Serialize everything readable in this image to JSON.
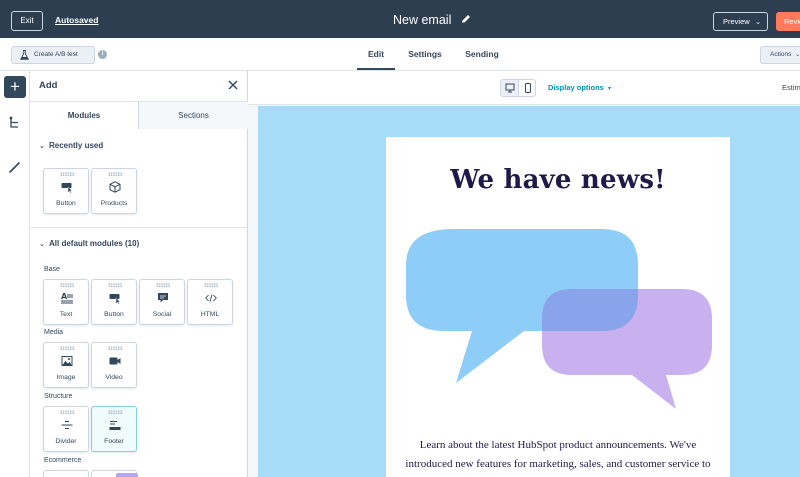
{
  "topbar": {
    "exit_label": "Exit",
    "autosaved_label": "Autosaved",
    "email_title": "New email",
    "preview_label": "Preview",
    "review_label": "Revie"
  },
  "subbar": {
    "ab_test_label": "Create A/B test",
    "tabs": [
      {
        "label": "Edit",
        "active": true
      },
      {
        "label": "Settings",
        "active": false
      },
      {
        "label": "Sending",
        "active": false
      }
    ],
    "actions_label": "Actions"
  },
  "panel": {
    "title": "Add",
    "tabs": [
      {
        "label": "Modules"
      },
      {
        "label": "Sections"
      }
    ],
    "recently_used": {
      "heading": "Recently used",
      "items": [
        {
          "label": "Button",
          "icon": "button-icon"
        },
        {
          "label": "Products",
          "icon": "cube-icon"
        }
      ]
    },
    "all_modules": {
      "heading": "All default modules (10)",
      "groups": [
        {
          "label": "Base",
          "items": [
            {
              "label": "Text",
              "icon": "text-icon"
            },
            {
              "label": "Button",
              "icon": "button-icon"
            },
            {
              "label": "Social",
              "icon": "social-icon"
            },
            {
              "label": "HTML",
              "icon": "code-icon"
            }
          ]
        },
        {
          "label": "Media",
          "items": [
            {
              "label": "Image",
              "icon": "image-icon"
            },
            {
              "label": "Video",
              "icon": "video-icon"
            }
          ]
        },
        {
          "label": "Structure",
          "items": [
            {
              "label": "Divider",
              "icon": "divider-icon"
            },
            {
              "label": "Footer",
              "icon": "footer-icon"
            }
          ]
        },
        {
          "label": "Ecommerce",
          "items": []
        }
      ]
    }
  },
  "canvas": {
    "display_options_label": "Display options",
    "estimate_label": "Estim",
    "headline": "We have news!",
    "body_lines": [
      "Learn about the latest HubSpot product announcements. We've",
      "introduced new features for marketing, sales, and customer service to"
    ],
    "colors": {
      "canvas_bg": "#a6dcf8",
      "bubble_blue": "#8ecdf7",
      "bubble_purple": "#c8b1ee",
      "overlap": "#8aa4ec",
      "headline": "#1e1b4b",
      "accent_orange": "#ff7a59",
      "link_teal": "#0091ae"
    }
  }
}
